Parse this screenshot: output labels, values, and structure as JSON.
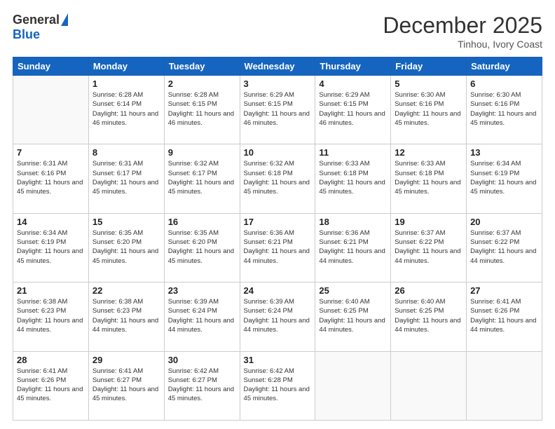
{
  "header": {
    "logo_general": "General",
    "logo_blue": "Blue",
    "title": "December 2025",
    "location": "Tinhou, Ivory Coast"
  },
  "days_of_week": [
    "Sunday",
    "Monday",
    "Tuesday",
    "Wednesday",
    "Thursday",
    "Friday",
    "Saturday"
  ],
  "weeks": [
    [
      {
        "day": "",
        "sunrise": "",
        "sunset": "",
        "daylight": ""
      },
      {
        "day": "1",
        "sunrise": "Sunrise: 6:28 AM",
        "sunset": "Sunset: 6:14 PM",
        "daylight": "Daylight: 11 hours and 46 minutes."
      },
      {
        "day": "2",
        "sunrise": "Sunrise: 6:28 AM",
        "sunset": "Sunset: 6:15 PM",
        "daylight": "Daylight: 11 hours and 46 minutes."
      },
      {
        "day": "3",
        "sunrise": "Sunrise: 6:29 AM",
        "sunset": "Sunset: 6:15 PM",
        "daylight": "Daylight: 11 hours and 46 minutes."
      },
      {
        "day": "4",
        "sunrise": "Sunrise: 6:29 AM",
        "sunset": "Sunset: 6:15 PM",
        "daylight": "Daylight: 11 hours and 46 minutes."
      },
      {
        "day": "5",
        "sunrise": "Sunrise: 6:30 AM",
        "sunset": "Sunset: 6:16 PM",
        "daylight": "Daylight: 11 hours and 45 minutes."
      },
      {
        "day": "6",
        "sunrise": "Sunrise: 6:30 AM",
        "sunset": "Sunset: 6:16 PM",
        "daylight": "Daylight: 11 hours and 45 minutes."
      }
    ],
    [
      {
        "day": "7",
        "sunrise": "Sunrise: 6:31 AM",
        "sunset": "Sunset: 6:16 PM",
        "daylight": "Daylight: 11 hours and 45 minutes."
      },
      {
        "day": "8",
        "sunrise": "Sunrise: 6:31 AM",
        "sunset": "Sunset: 6:17 PM",
        "daylight": "Daylight: 11 hours and 45 minutes."
      },
      {
        "day": "9",
        "sunrise": "Sunrise: 6:32 AM",
        "sunset": "Sunset: 6:17 PM",
        "daylight": "Daylight: 11 hours and 45 minutes."
      },
      {
        "day": "10",
        "sunrise": "Sunrise: 6:32 AM",
        "sunset": "Sunset: 6:18 PM",
        "daylight": "Daylight: 11 hours and 45 minutes."
      },
      {
        "day": "11",
        "sunrise": "Sunrise: 6:33 AM",
        "sunset": "Sunset: 6:18 PM",
        "daylight": "Daylight: 11 hours and 45 minutes."
      },
      {
        "day": "12",
        "sunrise": "Sunrise: 6:33 AM",
        "sunset": "Sunset: 6:18 PM",
        "daylight": "Daylight: 11 hours and 45 minutes."
      },
      {
        "day": "13",
        "sunrise": "Sunrise: 6:34 AM",
        "sunset": "Sunset: 6:19 PM",
        "daylight": "Daylight: 11 hours and 45 minutes."
      }
    ],
    [
      {
        "day": "14",
        "sunrise": "Sunrise: 6:34 AM",
        "sunset": "Sunset: 6:19 PM",
        "daylight": "Daylight: 11 hours and 45 minutes."
      },
      {
        "day": "15",
        "sunrise": "Sunrise: 6:35 AM",
        "sunset": "Sunset: 6:20 PM",
        "daylight": "Daylight: 11 hours and 45 minutes."
      },
      {
        "day": "16",
        "sunrise": "Sunrise: 6:35 AM",
        "sunset": "Sunset: 6:20 PM",
        "daylight": "Daylight: 11 hours and 45 minutes."
      },
      {
        "day": "17",
        "sunrise": "Sunrise: 6:36 AM",
        "sunset": "Sunset: 6:21 PM",
        "daylight": "Daylight: 11 hours and 44 minutes."
      },
      {
        "day": "18",
        "sunrise": "Sunrise: 6:36 AM",
        "sunset": "Sunset: 6:21 PM",
        "daylight": "Daylight: 11 hours and 44 minutes."
      },
      {
        "day": "19",
        "sunrise": "Sunrise: 6:37 AM",
        "sunset": "Sunset: 6:22 PM",
        "daylight": "Daylight: 11 hours and 44 minutes."
      },
      {
        "day": "20",
        "sunrise": "Sunrise: 6:37 AM",
        "sunset": "Sunset: 6:22 PM",
        "daylight": "Daylight: 11 hours and 44 minutes."
      }
    ],
    [
      {
        "day": "21",
        "sunrise": "Sunrise: 6:38 AM",
        "sunset": "Sunset: 6:23 PM",
        "daylight": "Daylight: 11 hours and 44 minutes."
      },
      {
        "day": "22",
        "sunrise": "Sunrise: 6:38 AM",
        "sunset": "Sunset: 6:23 PM",
        "daylight": "Daylight: 11 hours and 44 minutes."
      },
      {
        "day": "23",
        "sunrise": "Sunrise: 6:39 AM",
        "sunset": "Sunset: 6:24 PM",
        "daylight": "Daylight: 11 hours and 44 minutes."
      },
      {
        "day": "24",
        "sunrise": "Sunrise: 6:39 AM",
        "sunset": "Sunset: 6:24 PM",
        "daylight": "Daylight: 11 hours and 44 minutes."
      },
      {
        "day": "25",
        "sunrise": "Sunrise: 6:40 AM",
        "sunset": "Sunset: 6:25 PM",
        "daylight": "Daylight: 11 hours and 44 minutes."
      },
      {
        "day": "26",
        "sunrise": "Sunrise: 6:40 AM",
        "sunset": "Sunset: 6:25 PM",
        "daylight": "Daylight: 11 hours and 44 minutes."
      },
      {
        "day": "27",
        "sunrise": "Sunrise: 6:41 AM",
        "sunset": "Sunset: 6:26 PM",
        "daylight": "Daylight: 11 hours and 44 minutes."
      }
    ],
    [
      {
        "day": "28",
        "sunrise": "Sunrise: 6:41 AM",
        "sunset": "Sunset: 6:26 PM",
        "daylight": "Daylight: 11 hours and 45 minutes."
      },
      {
        "day": "29",
        "sunrise": "Sunrise: 6:41 AM",
        "sunset": "Sunset: 6:27 PM",
        "daylight": "Daylight: 11 hours and 45 minutes."
      },
      {
        "day": "30",
        "sunrise": "Sunrise: 6:42 AM",
        "sunset": "Sunset: 6:27 PM",
        "daylight": "Daylight: 11 hours and 45 minutes."
      },
      {
        "day": "31",
        "sunrise": "Sunrise: 6:42 AM",
        "sunset": "Sunset: 6:28 PM",
        "daylight": "Daylight: 11 hours and 45 minutes."
      },
      {
        "day": "",
        "sunrise": "",
        "sunset": "",
        "daylight": ""
      },
      {
        "day": "",
        "sunrise": "",
        "sunset": "",
        "daylight": ""
      },
      {
        "day": "",
        "sunrise": "",
        "sunset": "",
        "daylight": ""
      }
    ]
  ]
}
